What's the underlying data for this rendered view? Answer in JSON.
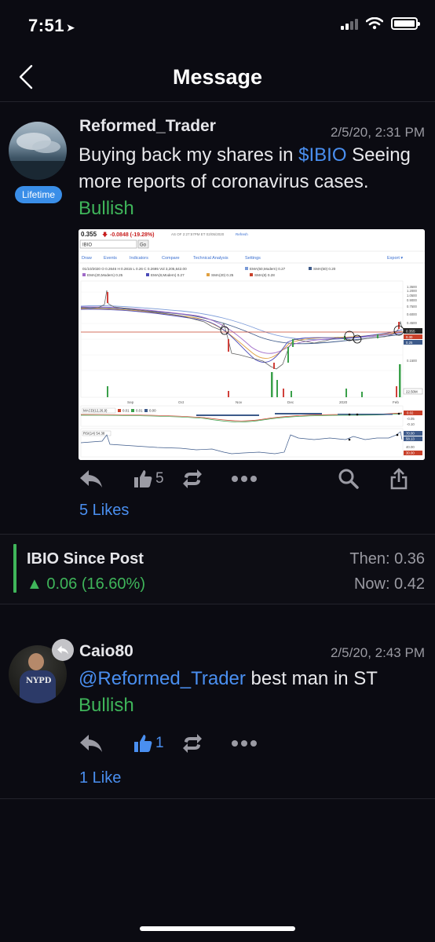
{
  "status_bar": {
    "time": "7:51"
  },
  "nav": {
    "title": "Message"
  },
  "post": {
    "username": "Reformed_Trader",
    "badge": "Lifetime",
    "timestamp": "2/5/20, 2:31 PM",
    "text_before": "Buying back my shares in ",
    "cashtag": "$IBIO",
    "text_after": " Seeing more reports of coronavirus cases.",
    "sentiment": "Bullish",
    "like_count": "5",
    "likes_link": "5 Likes"
  },
  "chart_image": {
    "price": "0.355",
    "change": "-0.0848 (-19.28%)",
    "as_of": "AS OF 2:27:57PM ET 02/05/2020",
    "refresh": "Refresh",
    "symbol": "IBIO",
    "go": "Go",
    "menu": [
      "Draw",
      "Events",
      "Indicators",
      "Compare",
      "Technical Analysis",
      "Settings"
    ],
    "export": "Export ▾",
    "ohlc": "01/10/2020  O 0.2646  H 0.2815  L 0.26  C 0.2695  Vol 3,205,642.00",
    "ema50": "EMA(50,Modern) 0.27",
    "sma50": "SMA(50) 0.20",
    "ema20": "EMA(20,Modern) 0.25",
    "ema8": "EMA(8,Modern) 0.27",
    "sma20": "SMA(20) 0.25",
    "sma8": "SMA(8) 0.28",
    "y_ticks": [
      "1.3500",
      "1.2000",
      "1.0500",
      "0.9000",
      "0.7500",
      "0.6000",
      "0.4500",
      "0.3500",
      "0.25",
      "0.1500"
    ],
    "current_label": "0.355",
    "current_label2": "0.30",
    "volume_label": "22.50M",
    "x_ticks": [
      "Sep",
      "Oct",
      "Nov",
      "Dec",
      "2020",
      "Feb"
    ],
    "macd_label": "MACD(12,26,9)",
    "macd_vals": [
      "0.01",
      "0.01",
      "0.00"
    ],
    "macd_ticks": [
      "0.02",
      "-0.05",
      "-0.10"
    ],
    "rsi_label": "RSI(14) 54.38",
    "rsi_ticks": [
      "70.00",
      "58.13",
      "40.00",
      "30.00"
    ]
  },
  "since_post": {
    "title": "IBIO Since Post",
    "change": "0.06 (16.60%)",
    "then": "Then: 0.36",
    "now": "Now: 0.42"
  },
  "reply": {
    "username": "Caio80",
    "timestamp": "2/5/20, 2:43 PM",
    "mention": "@Reformed_Trader",
    "text": " best man in ST",
    "sentiment": "Bullish",
    "like_count": "1",
    "likes_link": "1 Like",
    "shirt_text": "NYPD"
  },
  "colors": {
    "background": "#0b0b12",
    "accent_blue": "#4a8ff0",
    "bullish_green": "#3fb55a",
    "muted": "#9a9aa2"
  }
}
